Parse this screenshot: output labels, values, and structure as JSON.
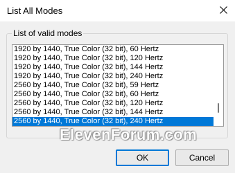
{
  "window": {
    "title": "List All Modes",
    "close_icon": "close-icon"
  },
  "group": {
    "label": "List of valid modes"
  },
  "modes": [
    "1920 by 1440, True Color (32 bit), 60 Hertz",
    "1920 by 1440, True Color (32 bit), 120 Hertz",
    "1920 by 1440, True Color (32 bit), 144 Hertz",
    "1920 by 1440, True Color (32 bit), 240 Hertz",
    "2560 by 1440, True Color (32 bit), 59 Hertz",
    "2560 by 1440, True Color (32 bit), 60 Hertz",
    "2560 by 1440, True Color (32 bit), 120 Hertz",
    "2560 by 1440, True Color (32 bit), 144 Hertz",
    "2560 by 1440, True Color (32 bit), 240 Hertz"
  ],
  "selected_index": 8,
  "watermark": "ElevenForum.com",
  "buttons": {
    "ok": "OK",
    "cancel": "Cancel"
  },
  "colors": {
    "selection": "#0078d7",
    "accent_border": "#0078d7"
  }
}
